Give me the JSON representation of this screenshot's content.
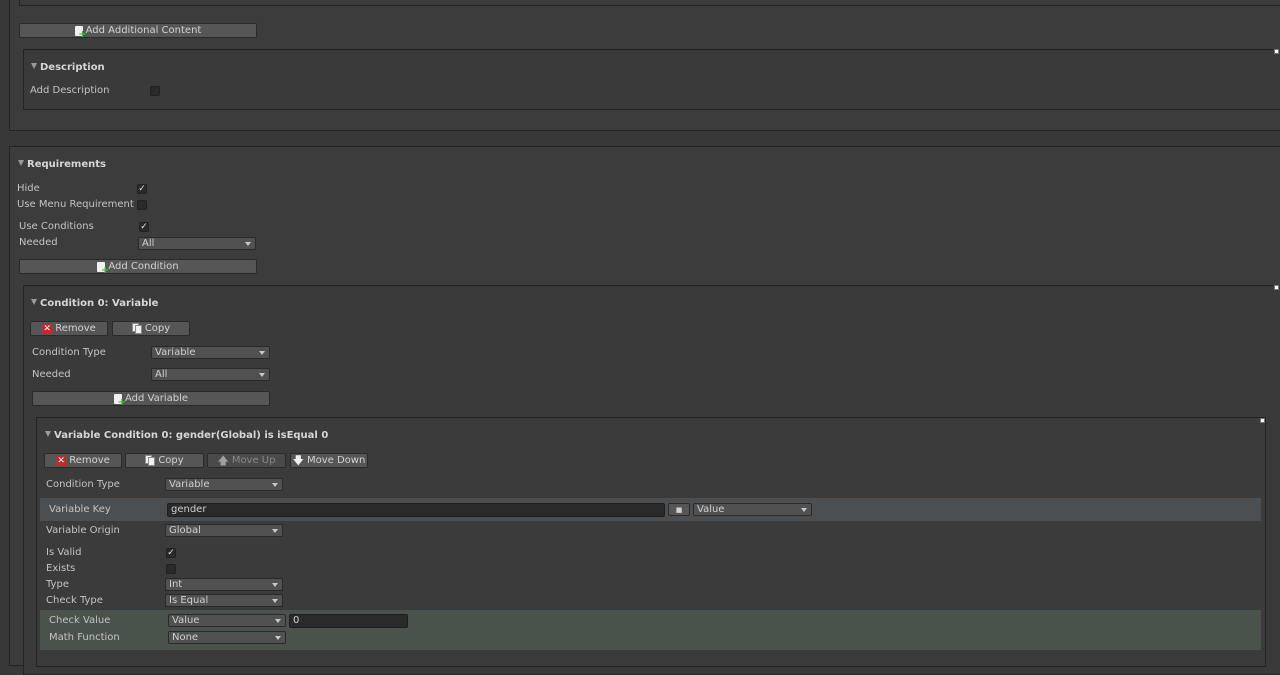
{
  "top": {
    "add_additional_content": "Add Additional Content"
  },
  "description": {
    "title": "Description",
    "add_description_label": "Add Description",
    "add_description_checked": false
  },
  "requirements": {
    "title": "Requirements",
    "hide_label": "Hide",
    "hide_checked": true,
    "use_menu_requirement_label": "Use Menu Requirement",
    "use_menu_requirement_checked": false,
    "use_conditions_label": "Use Conditions",
    "use_conditions_checked": true,
    "needed_label": "Needed",
    "needed_value": "All",
    "add_condition": "Add Condition"
  },
  "condition0": {
    "title": "Condition 0: Variable",
    "remove": "Remove",
    "copy": "Copy",
    "condition_type_label": "Condition Type",
    "condition_type_value": "Variable",
    "needed_label": "Needed",
    "needed_value": "All",
    "add_variable": "Add Variable"
  },
  "variable_condition0": {
    "title": "Variable Condition 0: gender(Global) is isEqual 0",
    "remove": "Remove",
    "copy": "Copy",
    "move_up": "Move Up",
    "move_down": "Move Down",
    "condition_type_label": "Condition Type",
    "condition_type_value": "Variable",
    "variable_key_label": "Variable Key",
    "variable_key_value": "gender",
    "variable_key_mode": "Value",
    "variable_origin_label": "Variable Origin",
    "variable_origin_value": "Global",
    "is_valid_label": "Is Valid",
    "is_valid_checked": true,
    "exists_label": "Exists",
    "exists_checked": false,
    "type_label": "Type",
    "type_value": "Int",
    "check_type_label": "Check Type",
    "check_type_value": "Is Equal",
    "check_value_label": "Check Value",
    "check_value_mode": "Value",
    "check_value_value": "0",
    "math_function_label": "Math Function",
    "math_function_value": "None"
  },
  "icons": {
    "check": "✓",
    "remove": "✕",
    "up": "🡅",
    "down": "🡇",
    "small_square": "■"
  },
  "colors": {
    "background": "#383838",
    "highlight_row": "#4c4f52",
    "highlight_row_green": "#4a524c"
  }
}
